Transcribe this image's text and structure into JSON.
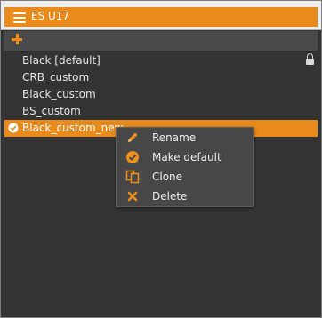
{
  "panel": {
    "title": "ES U17"
  },
  "toolbar": {
    "add_icon": "plus-icon"
  },
  "presets": [
    {
      "label": "Black [default]",
      "locked": true,
      "selected": false
    },
    {
      "label": "CRB_custom",
      "locked": false,
      "selected": false
    },
    {
      "label": "Black_custom",
      "locked": false,
      "selected": false
    },
    {
      "label": "BS_custom",
      "locked": false,
      "selected": false
    },
    {
      "label": "Black_custom_new",
      "locked": false,
      "selected": true
    }
  ],
  "context_menu": {
    "items": [
      {
        "label": "Rename",
        "icon": "pencil-icon"
      },
      {
        "label": "Make default",
        "icon": "check-circle-icon"
      },
      {
        "label": "Clone",
        "icon": "copy-icon"
      },
      {
        "label": "Delete",
        "icon": "x-icon"
      }
    ]
  },
  "colors": {
    "accent": "#e88a1c",
    "panel_bg": "#333333",
    "menu_bg": "#474747"
  }
}
